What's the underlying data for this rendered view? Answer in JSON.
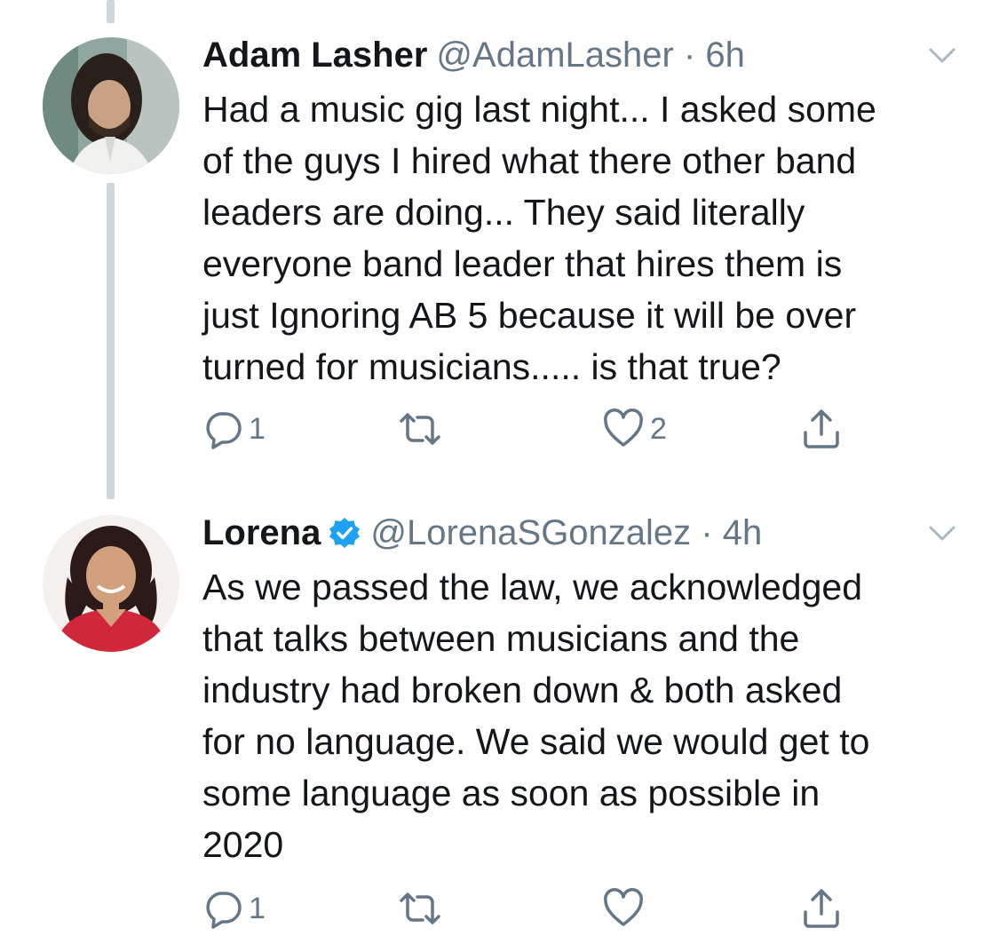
{
  "tweets": [
    {
      "display_name": "Adam Lasher",
      "verified": false,
      "handle": "@AdamLasher",
      "separator": "·",
      "time": "6h",
      "text_lines": [
        "Had a music gig last night... I asked some",
        "of the guys I hired what there other band",
        "leaders are doing... They said literally",
        "everyone band leader that hires them is",
        "just Ignoring AB 5 because it will be over",
        "turned for musicians..... is that true?"
      ],
      "reply_count": "1",
      "retweet_count": "",
      "like_count": "2",
      "icons": {
        "avatar": "adam-lasher-avatar",
        "menu": "chevron-down-icon",
        "reply": "reply-icon",
        "retweet": "retweet-icon",
        "like": "heart-icon",
        "share": "share-icon"
      }
    },
    {
      "display_name": "Lorena",
      "verified": true,
      "handle": "@LorenaSGonzalez",
      "separator": "·",
      "time": "4h",
      "text_lines": [
        "As we passed the law, we acknowledged",
        "that talks between musicians and the",
        "industry had broken down & both asked",
        "for no language. We said we would get to",
        "some language as soon as possible in",
        "2020"
      ],
      "reply_count": "1",
      "retweet_count": "",
      "like_count": "",
      "icons": {
        "avatar": "lorena-avatar",
        "verified": "verified-badge-icon",
        "menu": "chevron-down-icon",
        "reply": "reply-icon",
        "retweet": "retweet-icon",
        "like": "heart-icon",
        "share": "share-icon"
      }
    }
  ],
  "colors": {
    "text": "#14171a",
    "secondary_text": "#657786",
    "thread_line": "#ccd6dd",
    "verified_blue": "#1da1f2",
    "background": "#ffffff"
  }
}
